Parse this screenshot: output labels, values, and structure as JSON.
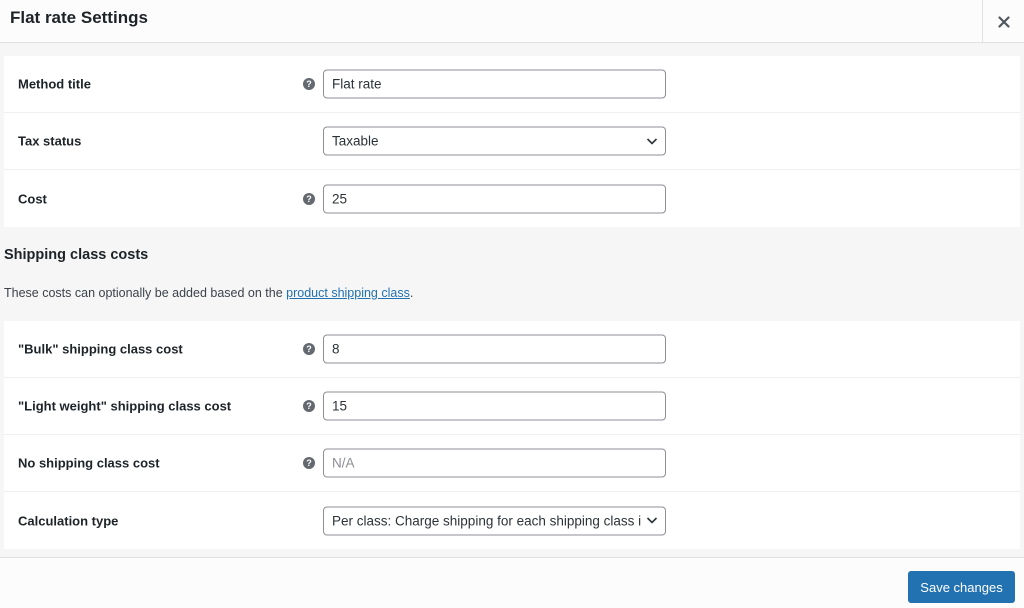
{
  "header": {
    "title": "Flat rate Settings",
    "close_icon": "close-x-icon"
  },
  "main_fields": [
    {
      "label": "Method title",
      "type": "text",
      "value": "Flat rate",
      "placeholder": "",
      "help": true
    },
    {
      "label": "Tax status",
      "type": "select",
      "value": "Taxable",
      "help": false
    },
    {
      "label": "Cost",
      "type": "text",
      "value": "25",
      "placeholder": "",
      "help": true
    }
  ],
  "shipping_class_section": {
    "heading": "Shipping class costs",
    "description_prefix": "These costs can optionally be added based on the ",
    "description_link": "product shipping class",
    "description_suffix": "."
  },
  "class_fields": [
    {
      "label": "\"Bulk\" shipping class cost",
      "type": "text",
      "value": "8",
      "placeholder": "",
      "help": true
    },
    {
      "label": "\"Light weight\" shipping class cost",
      "type": "text",
      "value": "15",
      "placeholder": "",
      "help": true
    },
    {
      "label": "No shipping class cost",
      "type": "text",
      "value": "",
      "placeholder": "N/A",
      "help": true
    },
    {
      "label": "Calculation type",
      "type": "select",
      "value": "Per class: Charge shipping for each shipping class individually",
      "help": false
    }
  ],
  "help_icon_glyph": "?",
  "footer": {
    "save_label": "Save changes"
  },
  "colors": {
    "primary": "#2271b1",
    "link": "#2271b1",
    "help_icon": "#646970"
  }
}
